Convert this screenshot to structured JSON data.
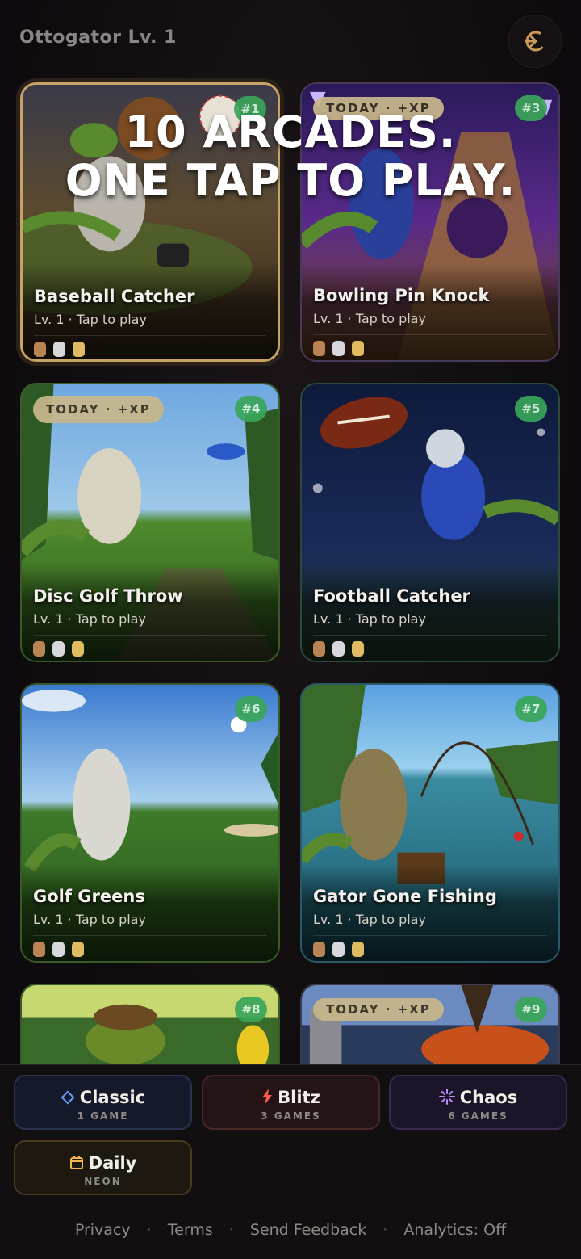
{
  "header": {
    "title": "Ottogator Lv. 1",
    "exit_icon": "exit-icon"
  },
  "hero": {
    "line1": "10 ARCADES.",
    "line2": "ONE TAP TO PLAY."
  },
  "games": [
    {
      "title": "Baseball Catcher",
      "subtitle": "Lv. 1 · Tap to play",
      "rank": "#1",
      "badge": ""
    },
    {
      "title": "Bowling Pin Knock",
      "subtitle": "Lv. 1 · Tap to play",
      "rank": "#3",
      "badge": "TODAY · +XP"
    },
    {
      "title": "Disc Golf Throw",
      "subtitle": "Lv. 1 · Tap to play",
      "rank": "#4",
      "badge": "TODAY · +XP"
    },
    {
      "title": "Football Catcher",
      "subtitle": "Lv. 1 · Tap to play",
      "rank": "#5",
      "badge": ""
    },
    {
      "title": "Golf Greens",
      "subtitle": "Lv. 1 · Tap to play",
      "rank": "#6",
      "badge": ""
    },
    {
      "title": "Gator Gone Fishing",
      "subtitle": "Lv. 1 · Tap to play",
      "rank": "#7",
      "badge": ""
    },
    {
      "title": "",
      "subtitle": "",
      "rank": "#8",
      "badge": ""
    },
    {
      "title": "",
      "subtitle": "",
      "rank": "#9",
      "badge": "TODAY · +XP"
    }
  ],
  "modes": [
    {
      "label": "Classic",
      "sub": "1 GAME",
      "icon": "diamond-icon",
      "color": "#6f9cff"
    },
    {
      "label": "Blitz",
      "sub": "3 GAMES",
      "icon": "lightning-icon",
      "color": "#ff5a4a"
    },
    {
      "label": "Chaos",
      "sub": "6 GAMES",
      "icon": "sparkle-icon",
      "color": "#b98cff"
    },
    {
      "label": "Daily",
      "sub": "NEON",
      "icon": "calendar-icon",
      "color": "#f2b64c"
    }
  ],
  "footer": {
    "privacy": "Privacy",
    "terms": "Terms",
    "feedback": "Send Feedback",
    "analytics": "Analytics: Off",
    "sep": "·"
  }
}
